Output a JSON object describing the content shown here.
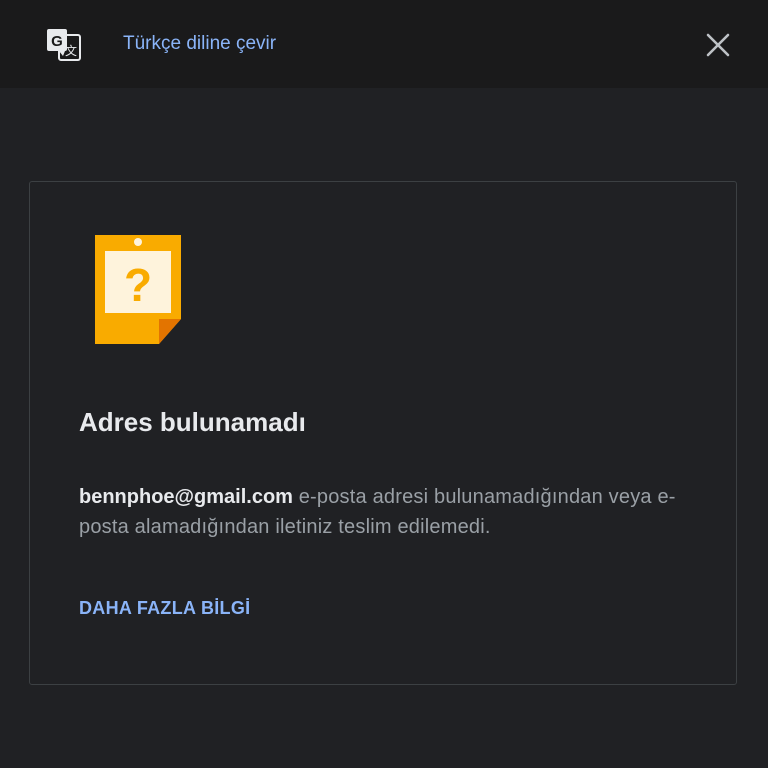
{
  "topbar": {
    "translate_link": "Türkçe diline çevir",
    "translate_icon": "google-translate-icon",
    "close_icon": "close-icon"
  },
  "card": {
    "icon": "question-note-icon",
    "title": "Adres bulunamadı",
    "email": "bennphoe@gmail.com",
    "message": " e-posta adresi bulunamadığından veya e-posta alamadığından iletiniz teslim edilemedi.",
    "learn_more": "DAHA FAZLA BİLGİ"
  },
  "colors": {
    "background": "#202124",
    "topbar": "#1a1a1b",
    "link": "#8ab4f8",
    "note_orange": "#f9ab00",
    "note_dark_orange": "#e37400"
  }
}
